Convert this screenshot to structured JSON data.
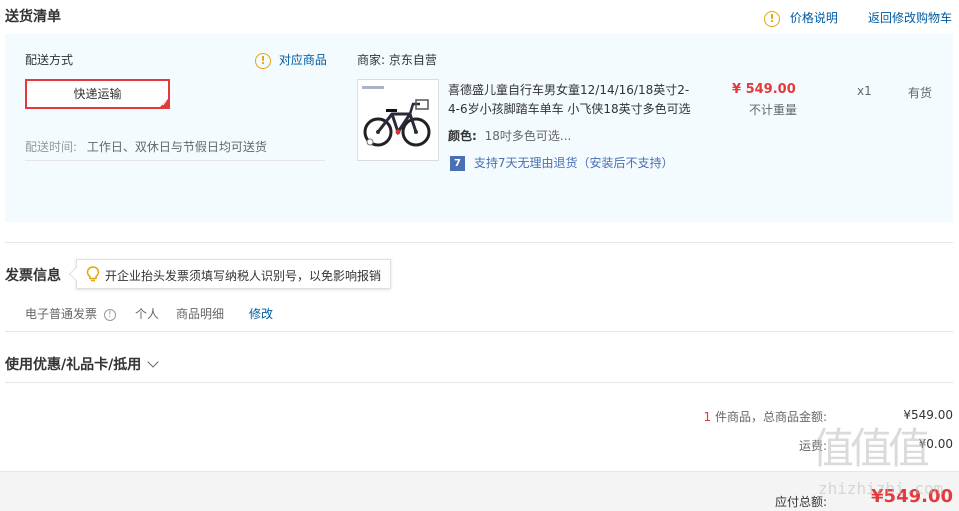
{
  "header": {
    "title": "送货清单",
    "price_info_label": "价格说明",
    "back_cart_link": "返回修改购物车"
  },
  "shipping": {
    "method_title": "配送方式",
    "match_goods_label": "对应商品",
    "method_option": "快递运输",
    "time_label": "配送时间:",
    "time_value": "工作日、双休日与节假日均可送货"
  },
  "seller": {
    "label": "商家:",
    "name": "京东自营"
  },
  "product": {
    "title_line1": "喜德盛儿童自行车男女童12/14/16/18英寸2-",
    "title_line2": "4-6岁小孩脚踏车单车 小飞侠18英寸多色可选",
    "color_label": "颜色:",
    "color_value": "18吋多色可选...",
    "return_badge": "7",
    "return_policy": "支持7天无理由退货（安装后不支持）",
    "price": "¥ 549.00",
    "weight_note": "不计重量",
    "quantity": "x1",
    "stock": "有货"
  },
  "invoice": {
    "title": "发票信息",
    "tip": "开企业抬头发票须填写纳税人识别号，以免影响报销",
    "type": "电子普通发票",
    "info_mark": "!",
    "personal": "个人",
    "detail": "商品明细",
    "edit": "修改"
  },
  "coupon": {
    "title": "使用优惠/礼品卡/抵用"
  },
  "summary": {
    "item_count": "1",
    "item_count_suffix": "件商品，总商品金额:",
    "goods_total": "¥549.00",
    "freight_label": "运费:",
    "freight_value": "¥0.00",
    "payable_label": "应付总额:",
    "payable_value": "¥549.00"
  },
  "watermark": {
    "logo": "值值值",
    "site": "zhizhizhi.com"
  },
  "colors": {
    "accent_red": "#e4393c",
    "link_blue": "#005aa0",
    "info_orange": "#e4a40d",
    "ship_bg": "#f3fbfe"
  }
}
